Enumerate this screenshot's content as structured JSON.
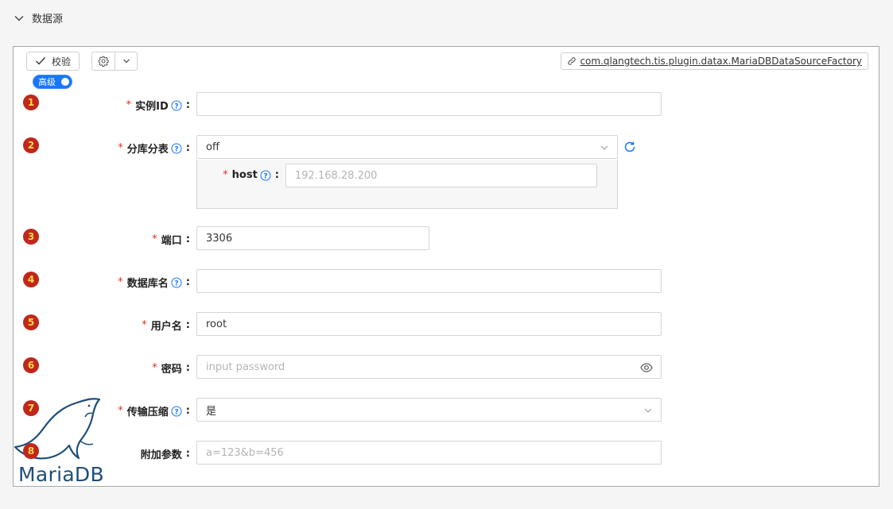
{
  "section": {
    "title": "数据源"
  },
  "toolbar": {
    "validate_label": "校验",
    "plugin_class": "com.qlangtech.tis.plugin.datax.MariaDBDataSourceFactory",
    "advanced_toggle_label": "高级"
  },
  "fields": [
    {
      "num": "1",
      "label": "实例ID",
      "required": true,
      "help": true,
      "value": "",
      "placeholder": ""
    },
    {
      "num": "2",
      "label": "分库分表",
      "required": true,
      "help": true,
      "value": "off",
      "type": "select"
    },
    {
      "num": "3",
      "label": "端口",
      "required": true,
      "help": false,
      "value": "3306"
    },
    {
      "num": "4",
      "label": "数据库名",
      "required": true,
      "help": true,
      "value": ""
    },
    {
      "num": "5",
      "label": "用户名",
      "required": true,
      "help": false,
      "value": "root"
    },
    {
      "num": "6",
      "label": "密码",
      "required": true,
      "help": false,
      "value": "",
      "placeholder": "input password"
    },
    {
      "num": "7",
      "label": "传输压缩",
      "required": true,
      "help": true,
      "value": "是",
      "type": "select"
    },
    {
      "num": "8",
      "label": "附加参数",
      "required": false,
      "help": false,
      "value": "",
      "placeholder": "a=123&b=456"
    }
  ],
  "sub_field": {
    "label": "host",
    "required": true,
    "help": true,
    "placeholder": "192.168.28.200"
  },
  "logo": {
    "text": "MariaDB"
  },
  "colors": {
    "accent": "#1677ff",
    "required": "#e0301e",
    "badge": "#c0271c",
    "badge_text": "#ffd84a"
  }
}
